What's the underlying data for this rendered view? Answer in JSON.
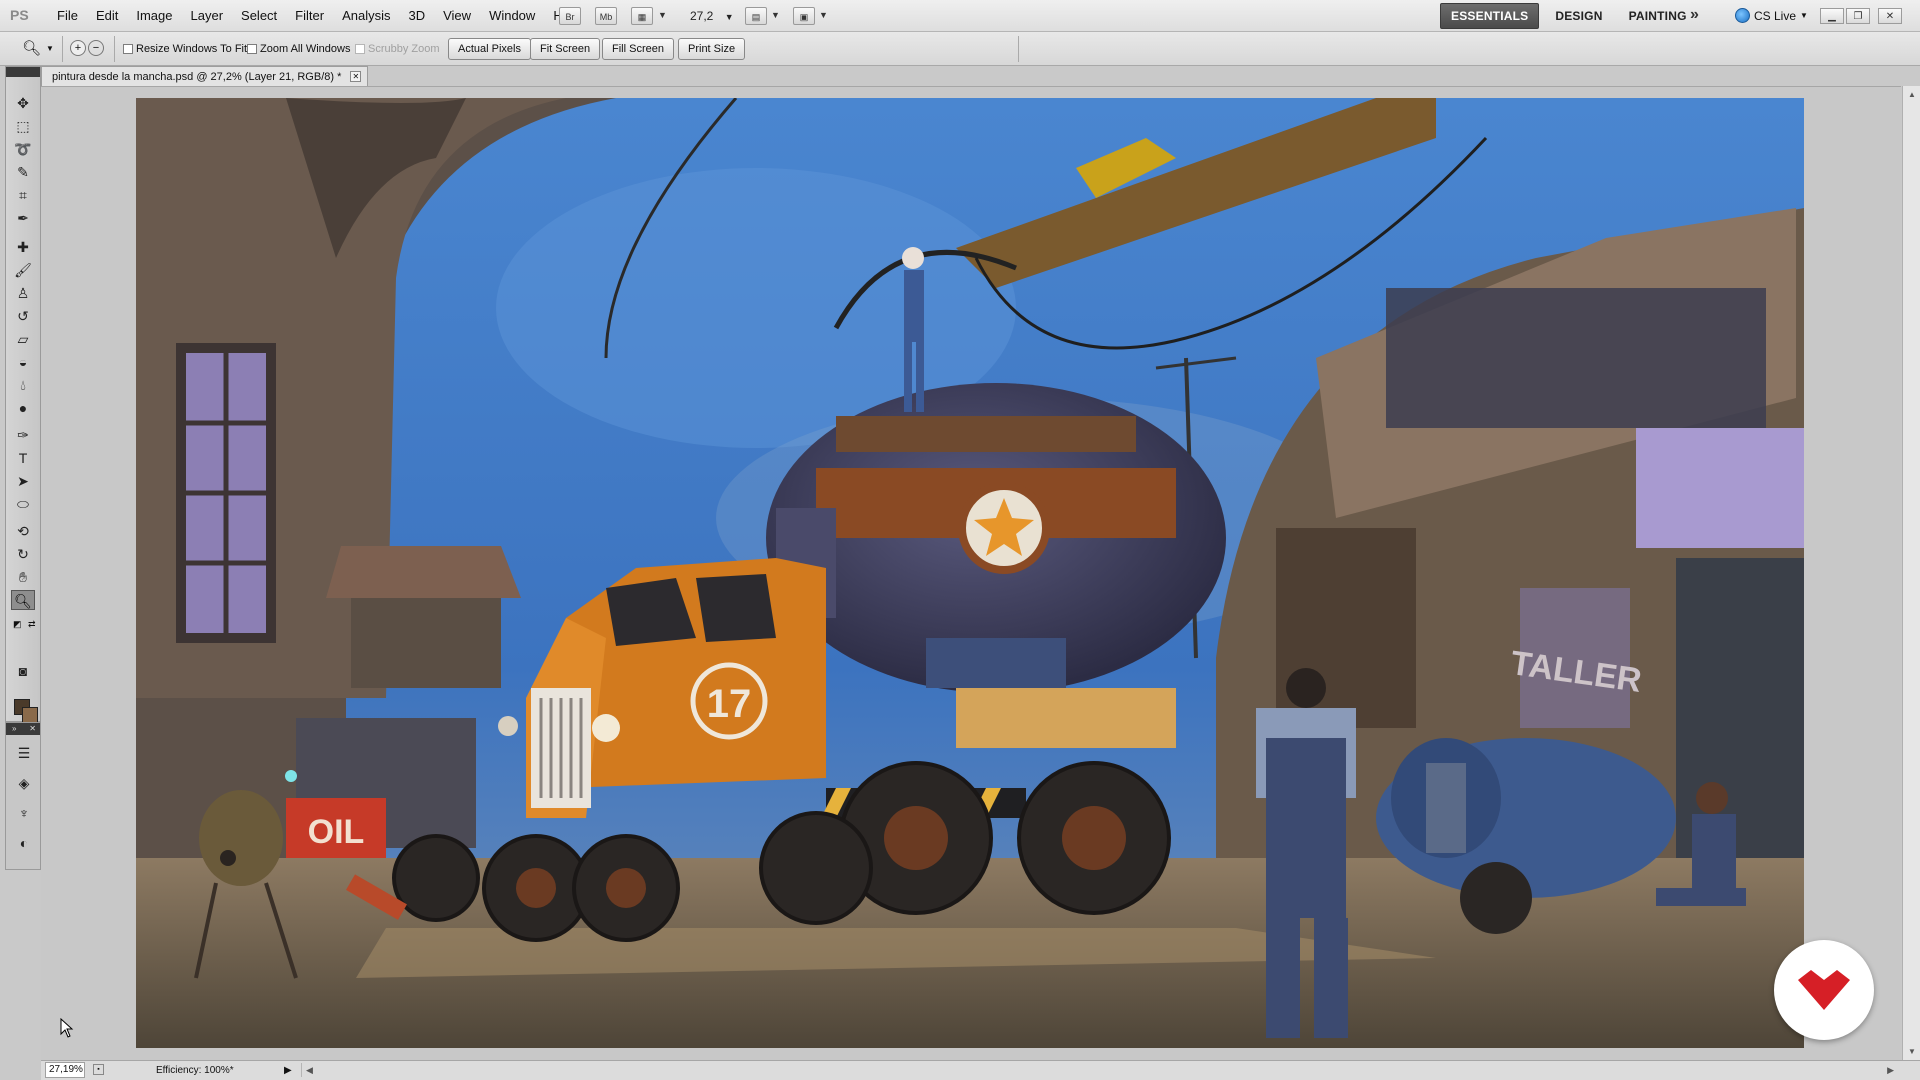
{
  "app": {
    "logo": "PS",
    "menu": [
      "File",
      "Edit",
      "Image",
      "Layer",
      "Select",
      "Filter",
      "Analysis",
      "3D",
      "View",
      "Window",
      "Help"
    ],
    "bridge_button": "Br",
    "minibridge_button": "Mb",
    "zoom_combo": "27,2",
    "workspaces": [
      "ESSENTIALS",
      "DESIGN",
      "PAINTING"
    ],
    "active_workspace": "ESSENTIALS",
    "cs_live": "CS Live"
  },
  "options": {
    "resize_windows": "Resize Windows To Fit",
    "zoom_all": "Zoom All Windows",
    "scrubby_zoom": "Scrubby Zoom",
    "buttons": [
      "Actual Pixels",
      "Fit Screen",
      "Fill Screen",
      "Print Size"
    ]
  },
  "document": {
    "tab_title": "pintura desde la mancha.psd @ 27,2% (Layer 21, RGB/8) *",
    "painting_texts": {
      "truck_number": "17",
      "oil_sign": "OIL",
      "taller_sign": "TALLER"
    }
  },
  "status": {
    "zoom": "27,19%",
    "efficiency": "Efficiency: 100%*"
  },
  "colors": {
    "foreground": "#4a3a2a",
    "background": "#8a6a4a",
    "sky": "#3f78c4",
    "truck_orange": "#d27a1e",
    "badge_red": "#d61f26"
  }
}
